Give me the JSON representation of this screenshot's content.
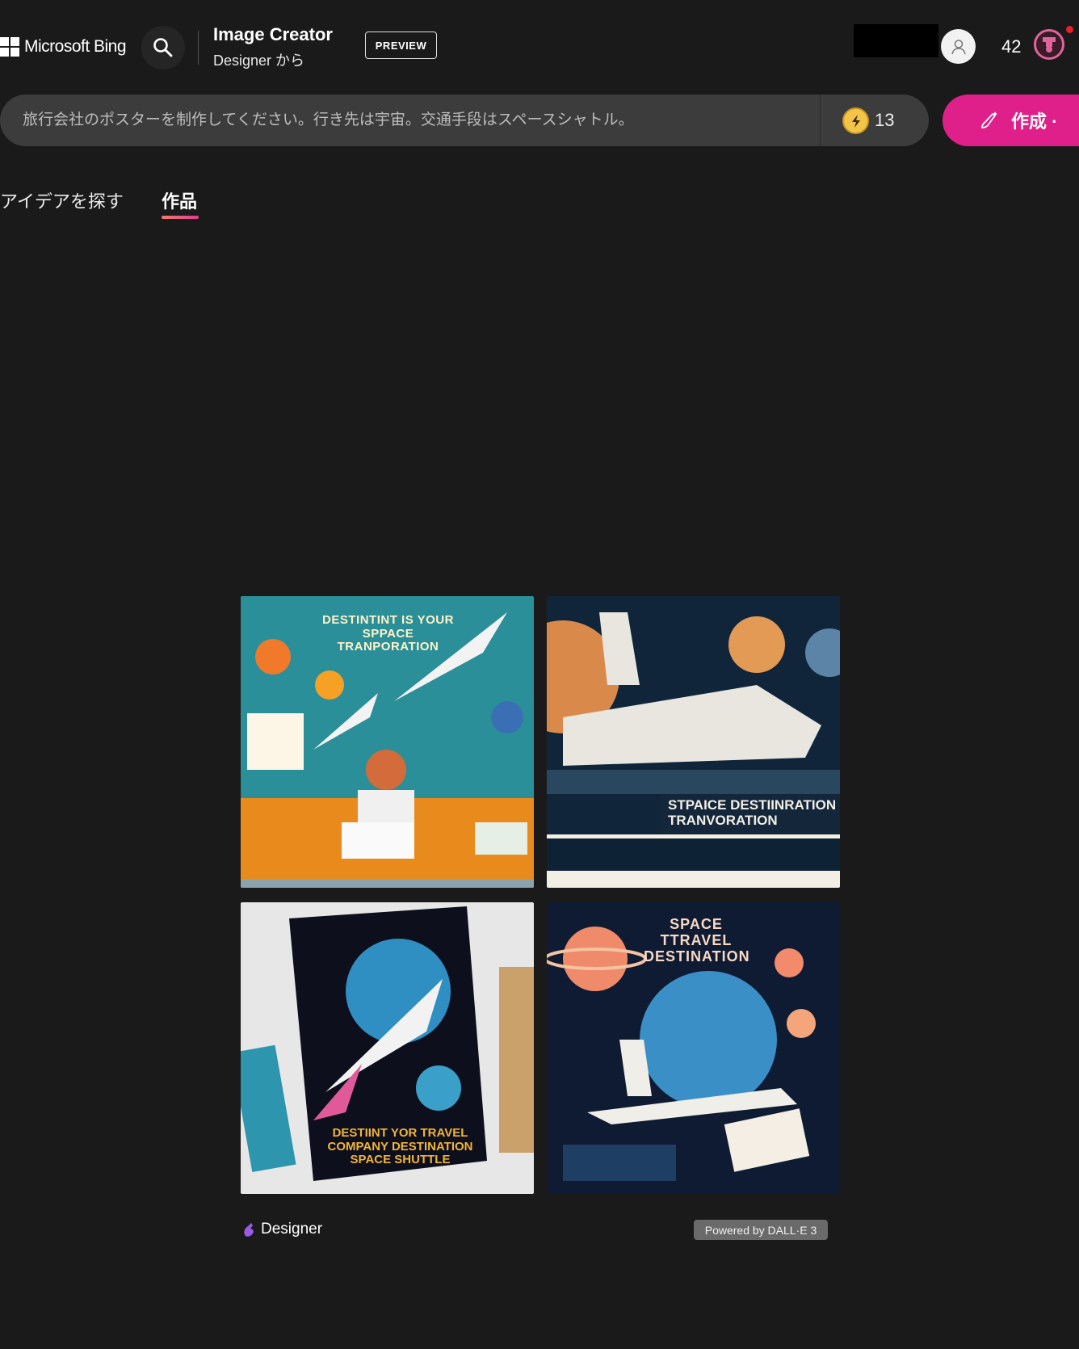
{
  "header": {
    "brand": "Microsoft Bing",
    "app_title": "Image Creator",
    "app_subtitle": "Designer から",
    "preview_badge": "PREVIEW",
    "points": "42",
    "icons": {
      "search": "search-icon",
      "avatar": "user-icon",
      "rewards": "trophy-icon"
    }
  },
  "prompt_bar": {
    "value": "旅行会社のポスターを制作してください。行き先は宇宙。交通手段はスペースシャトル。",
    "boosts": "13",
    "create_label": "作成 ·",
    "icons": {
      "boost": "lightning-coin-icon",
      "create": "brush-sparkle-icon"
    }
  },
  "tabs": [
    {
      "label": "アイデアを探す",
      "active": false
    },
    {
      "label": "作品",
      "active": true
    }
  ],
  "results": {
    "images": [
      {
        "lettering": "DESTINTINT IS YOUR SPPACE TRANPORATION"
      },
      {
        "lettering": "STPAICE DESTIINRATION TRANVORATION"
      },
      {
        "lettering": "DESTIINT YOR TRAVEL COMPANY DESTINATION SPACE SHUTTLE"
      },
      {
        "lettering": "SPACE TTRAVEL DESTINATION"
      }
    ]
  },
  "footer": {
    "designer_label": "Designer",
    "powered_by": "Powered by DALL·E 3"
  },
  "colors": {
    "accent": "#e0208a",
    "background": "#1b1a1a",
    "search_bar": "#3d3c3c"
  }
}
